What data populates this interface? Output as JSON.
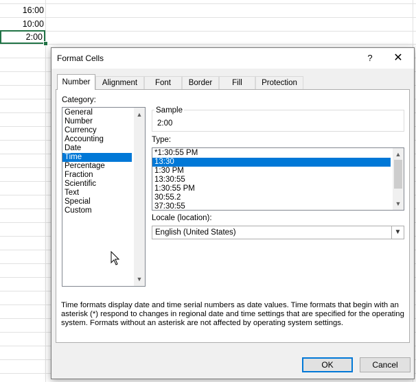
{
  "spreadsheet": {
    "cells": [
      "16:00",
      "10:00",
      "2:00"
    ],
    "selected_index": 2
  },
  "dialog": {
    "title": "Format Cells",
    "help_label": "?",
    "close_label": "✕",
    "tabs": [
      {
        "label": "Number",
        "active": true
      },
      {
        "label": "Alignment",
        "active": false
      },
      {
        "label": "Font",
        "active": false
      },
      {
        "label": "Border",
        "active": false
      },
      {
        "label": "Fill",
        "active": false
      },
      {
        "label": "Protection",
        "active": false
      }
    ],
    "category_label": "Category:",
    "categories": [
      "General",
      "Number",
      "Currency",
      "Accounting",
      "Date",
      "Time",
      "Percentage",
      "Fraction",
      "Scientific",
      "Text",
      "Special",
      "Custom"
    ],
    "selected_category": "Time",
    "sample_label": "Sample",
    "sample_value": "2:00",
    "type_label": "Type:",
    "types": [
      "*1:30:55 PM",
      "13:30",
      "1:30 PM",
      "13:30:55",
      "1:30:55 PM",
      "30:55.2",
      "37:30:55"
    ],
    "selected_type": "13:30",
    "locale_label": "Locale (location):",
    "locale_value": "English (United States)",
    "description": "Time formats display date and time serial numbers as date values.  Time formats that begin with an asterisk (*) respond to changes in regional date and time settings that are specified for the operating system. Formats without an asterisk are not affected by operating system settings.",
    "ok_label": "OK",
    "cancel_label": "Cancel"
  },
  "colors": {
    "selection": "#0078d7",
    "excel_green": "#217346"
  }
}
